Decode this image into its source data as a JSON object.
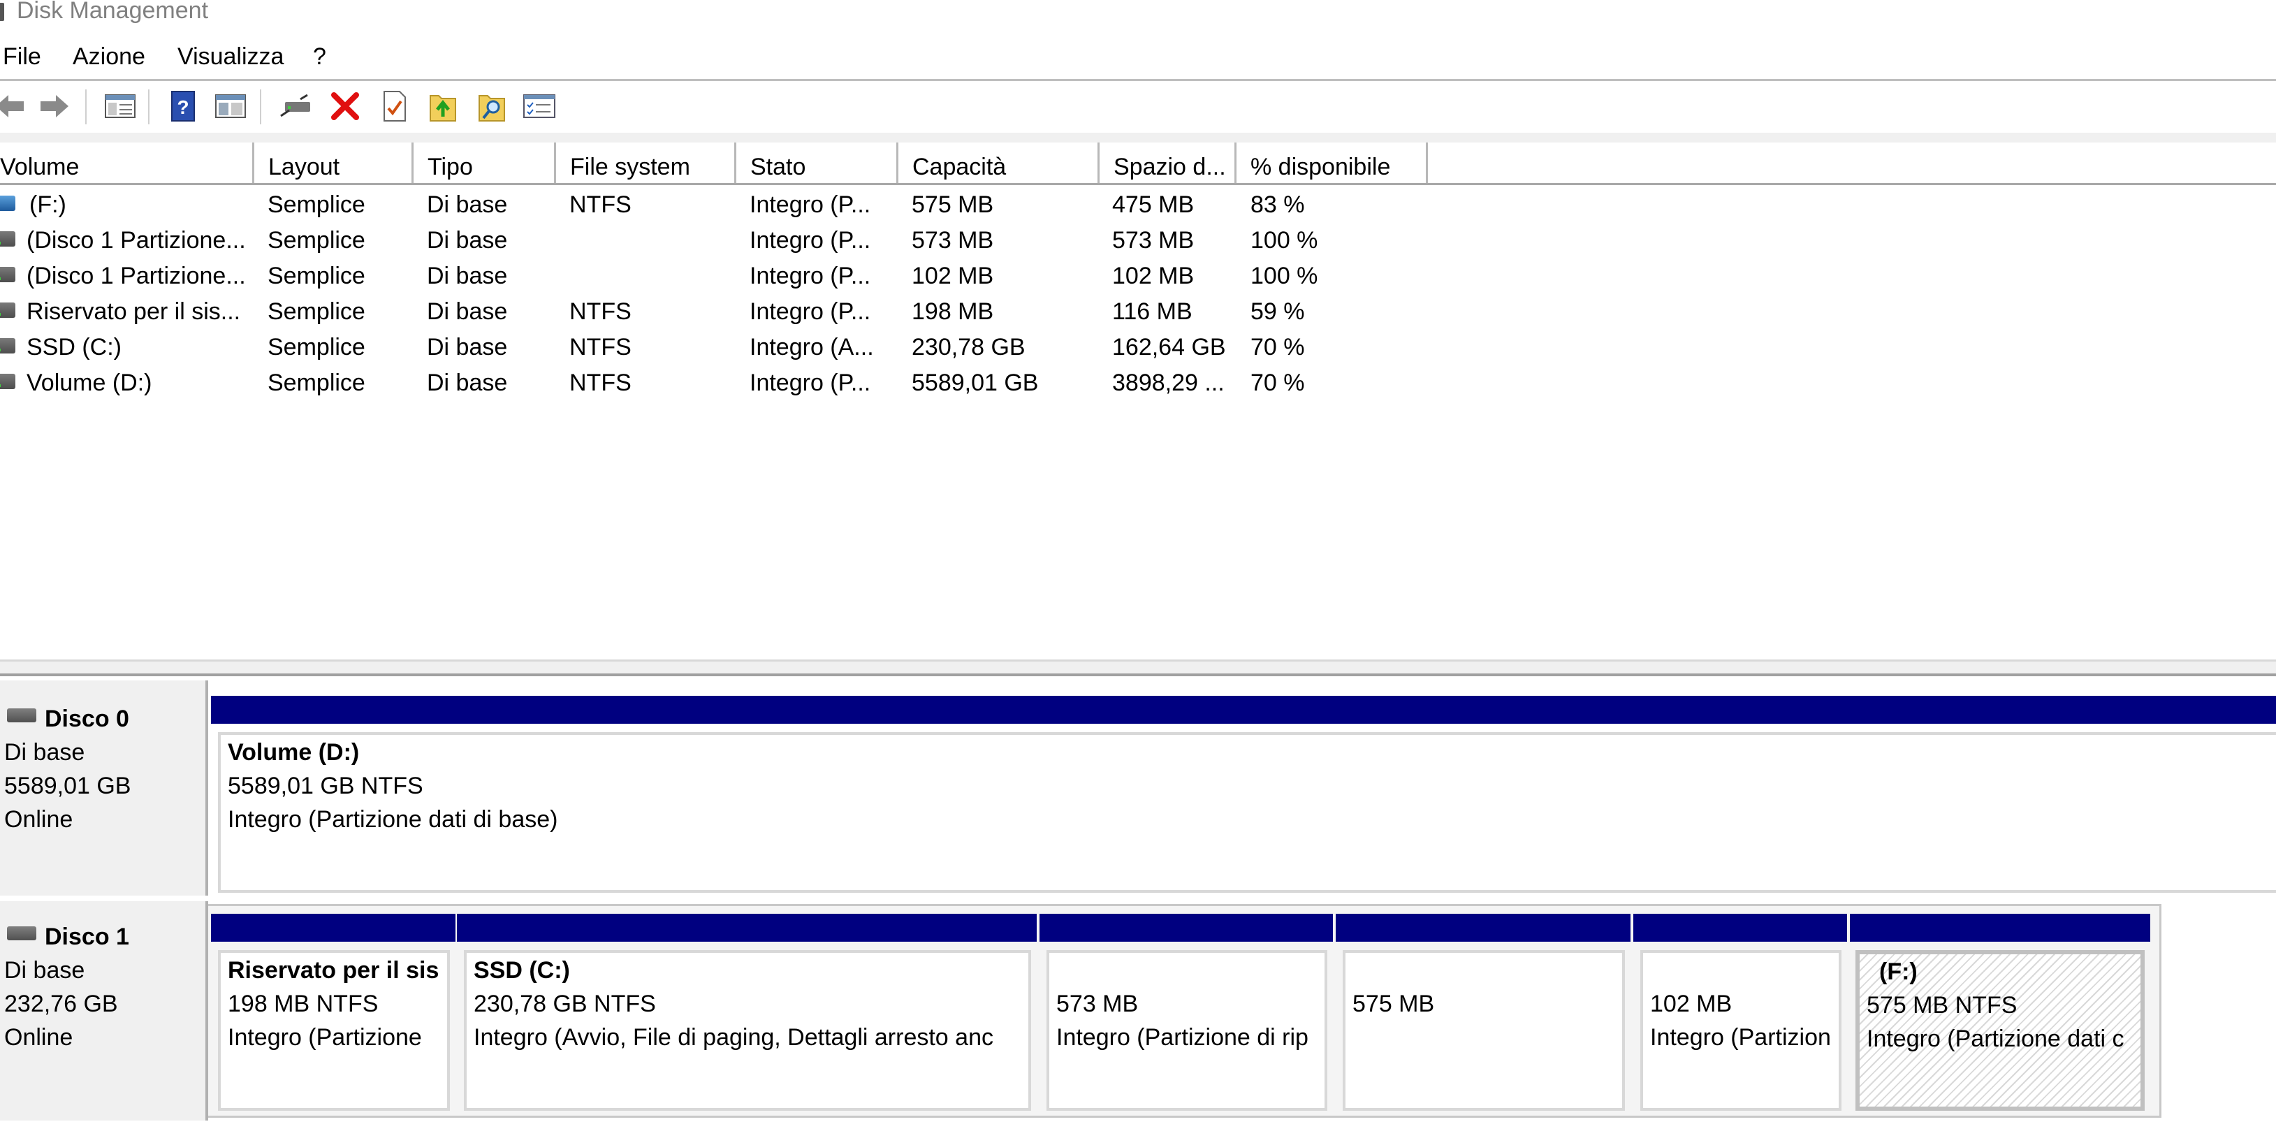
{
  "window": {
    "title": "Disk Management"
  },
  "menu": [
    "File",
    "Azione",
    "Visualizza",
    "?"
  ],
  "toolbar": {
    "buttons": [
      "back-arrow-icon",
      "forward-arrow-icon",
      "console-tree-icon",
      "help-icon",
      "show-hide-pane-icon",
      "connect-drive-icon",
      "delete-icon",
      "properties-icon",
      "refresh-icon",
      "rescan-disks-icon",
      "options-icon"
    ]
  },
  "volumes": {
    "columns": [
      "Volume",
      "Layout",
      "Tipo",
      "File system",
      "Stato",
      "Capacità",
      "Spazio d...",
      "% disponibile"
    ],
    "rows": [
      {
        "volume": "(F:)",
        "layout": "Semplice",
        "tipo": "Di base",
        "fs": "NTFS",
        "stato": "Integro (P...",
        "capacita": "575 MB",
        "spazio": "475 MB",
        "disp": "83 %",
        "icon": "blue"
      },
      {
        "volume": "(Disco 1 Partizione...",
        "layout": "Semplice",
        "tipo": "Di base",
        "fs": "",
        "stato": "Integro (P...",
        "capacita": "573 MB",
        "spazio": "573 MB",
        "disp": "100 %",
        "icon": "gray"
      },
      {
        "volume": "(Disco 1 Partizione...",
        "layout": "Semplice",
        "tipo": "Di base",
        "fs": "",
        "stato": "Integro (P...",
        "capacita": "102 MB",
        "spazio": "102 MB",
        "disp": "100 %",
        "icon": "gray"
      },
      {
        "volume": "Riservato per il sis...",
        "layout": "Semplice",
        "tipo": "Di base",
        "fs": "NTFS",
        "stato": "Integro (P...",
        "capacita": "198 MB",
        "spazio": "116 MB",
        "disp": "59 %",
        "icon": "gray"
      },
      {
        "volume": "SSD (C:)",
        "layout": "Semplice",
        "tipo": "Di base",
        "fs": "NTFS",
        "stato": "Integro (A...",
        "capacita": "230,78 GB",
        "spazio": "162,64 GB",
        "disp": "70 %",
        "icon": "gray"
      },
      {
        "volume": "Volume (D:)",
        "layout": "Semplice",
        "tipo": "Di base",
        "fs": "NTFS",
        "stato": "Integro (P...",
        "capacita": "5589,01 GB",
        "spazio": "3898,29 ...",
        "disp": "70 %",
        "icon": "gray"
      }
    ]
  },
  "disks": [
    {
      "name": "Disco 0",
      "type": "Di base",
      "size": "5589,01 GB",
      "status": "Online",
      "partitions": [
        {
          "title": "Volume  (D:)",
          "line2": "5589,01 GB NTFS",
          "line3": "Integro (Partizione dati di base)"
        }
      ]
    },
    {
      "name": "Disco 1",
      "type": "Di base",
      "size": "232,76 GB",
      "status": "Online",
      "partitions": [
        {
          "title": "Riservato per il sis",
          "line2": "198 MB NTFS",
          "line3": "Integro (Partizione"
        },
        {
          "title": "SSD  (C:)",
          "line2": "230,78 GB NTFS",
          "line3": "Integro (Avvio, File di paging, Dettagli arresto anc"
        },
        {
          "title": "",
          "line2": "573 MB",
          "line3": "Integro (Partizione di rip"
        },
        {
          "title": "",
          "line2": "575 MB",
          "line3": ""
        },
        {
          "title": "",
          "line2": "102 MB",
          "line3": "Integro (Partizion"
        },
        {
          "title": "(F:)",
          "line2": "575 MB NTFS",
          "line3": "Integro (Partizione dati c",
          "selected": true
        }
      ]
    }
  ]
}
